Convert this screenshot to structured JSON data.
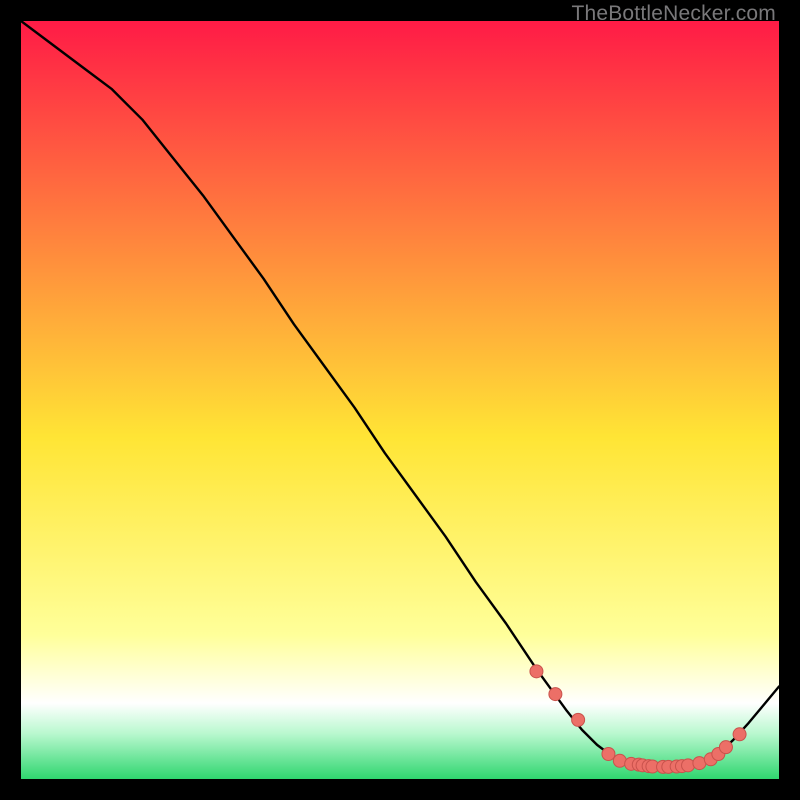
{
  "watermark": "TheBottleNecker.com",
  "colors": {
    "frame": "#000000",
    "curve": "#000000",
    "marker_fill": "#ec6f67",
    "marker_stroke": "#c9524c",
    "grad_top": "#ff1b46",
    "grad_yellow": "#ffe535",
    "grad_lightyellow": "#ffff9a",
    "grad_white": "#ffffff",
    "grad_green": "#2fd66f"
  },
  "chart_data": {
    "type": "line",
    "title": "",
    "xlabel": "",
    "ylabel": "",
    "xlim": [
      0,
      100
    ],
    "ylim": [
      0,
      100
    ],
    "series": [
      {
        "name": "bottleneck-curve",
        "x": [
          0,
          4,
          8,
          12,
          16,
          20,
          24,
          28,
          32,
          36,
          40,
          44,
          48,
          52,
          56,
          60,
          64,
          68,
          72,
          74,
          76,
          78,
          80,
          82,
          84,
          86,
          88,
          90,
          92,
          94,
          96,
          98,
          100
        ],
        "values": [
          100,
          97,
          94,
          91,
          87,
          82,
          77,
          71.5,
          66,
          60,
          54.5,
          49,
          43,
          37.5,
          32,
          26,
          20.5,
          14.5,
          9,
          6.5,
          4.5,
          3,
          2.2,
          1.8,
          1.6,
          1.6,
          1.8,
          2.3,
          3.3,
          5.2,
          7.4,
          9.8,
          12.2
        ]
      }
    ],
    "markers": {
      "name": "highlighted-points",
      "x": [
        68,
        70.5,
        73.5,
        77.5,
        79,
        80.5,
        81.5,
        82,
        82.8,
        83.3,
        84.7,
        85.4,
        86.5,
        87.2,
        88,
        89.5,
        91,
        92,
        93,
        94.8
      ],
      "values": [
        14.2,
        11.2,
        7.8,
        3.3,
        2.4,
        2.0,
        1.9,
        1.8,
        1.7,
        1.65,
        1.6,
        1.6,
        1.65,
        1.7,
        1.8,
        2.1,
        2.6,
        3.3,
        4.2,
        5.9
      ]
    }
  }
}
